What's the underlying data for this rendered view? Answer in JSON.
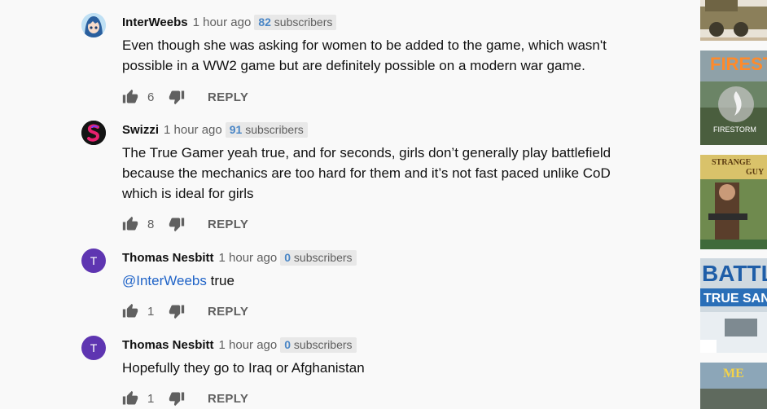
{
  "comments": [
    {
      "author": "InterWeebs",
      "time": "1 hour ago",
      "subs_count": "82",
      "subs_label": " subscribers",
      "text": "Even though she was asking for women to be added to the game, which wasn't possible in a WW2 game but are definitely possible on a modern war game.",
      "likes": "6",
      "reply": "REPLY"
    },
    {
      "author": "Swizzi",
      "time": "1 hour ago",
      "subs_count": "91",
      "subs_label": " subscribers",
      "text": "The True Gamer yeah true, and for seconds, girls don’t generally play battlefield because the mechanics are too hard for them and it’s not fast paced unlike CoD which is ideal for girls",
      "likes": "8",
      "reply": "REPLY"
    },
    {
      "author": "Thomas Nesbitt",
      "avatar_letter": "T",
      "time": "1 hour ago",
      "subs_count": "0",
      "subs_label": " subscribers",
      "mention": "@InterWeebs",
      "text": " true",
      "likes": "1",
      "reply": "REPLY"
    },
    {
      "author": "Thomas Nesbitt",
      "avatar_letter": "T",
      "time": "1 hour ago",
      "subs_count": "0",
      "subs_label": " subscribers",
      "text": "Hopefully they go to Iraq or Afghanistan",
      "likes": "1",
      "reply": "REPLY"
    }
  ],
  "sidebar": {
    "thumbnails": [
      {
        "text": ""
      },
      {
        "text": "FIREST",
        "sub": "FIRESTORM"
      },
      {
        "text": "STRANGE",
        "sub": "GUY"
      },
      {
        "text": "BATTL",
        "sub": "TRUE SAN"
      },
      {
        "text": "ME"
      }
    ]
  },
  "colors": {
    "avatar_purple": "#5e35b1",
    "subs_count_blue": "#4a86c6",
    "mention_blue": "#1f63c7"
  }
}
